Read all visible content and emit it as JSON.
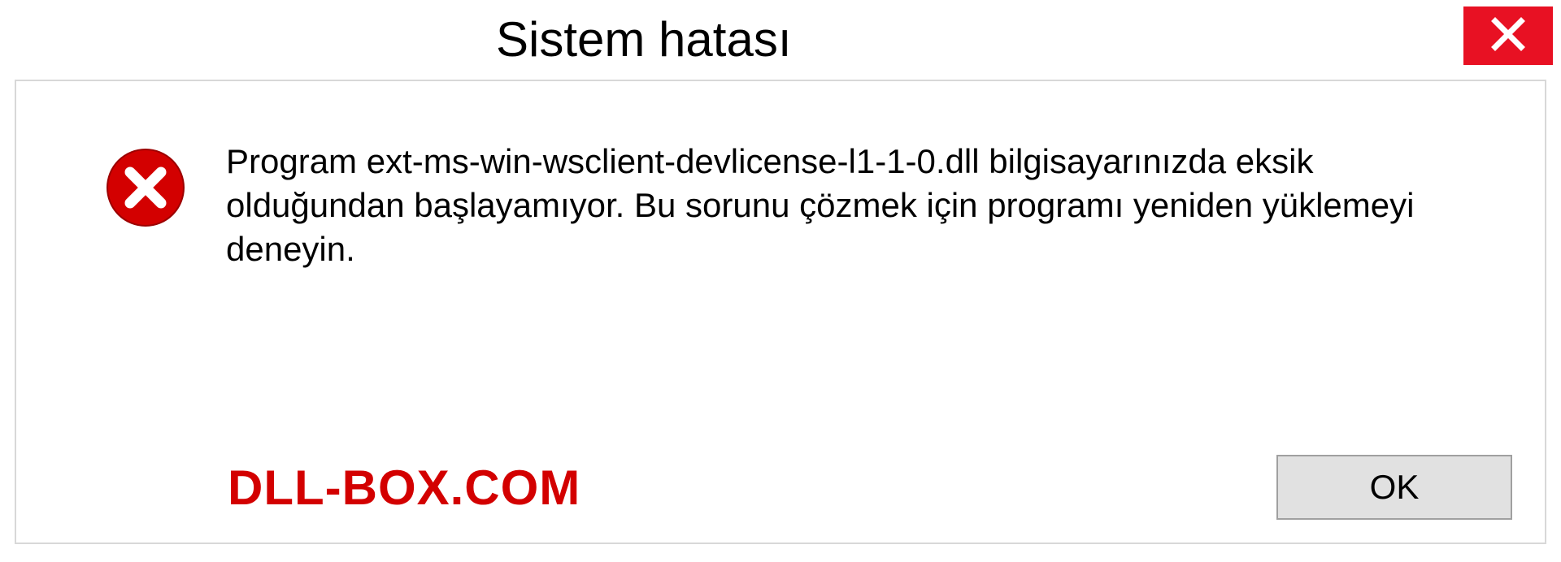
{
  "titlebar": {
    "title": "Sistem hatası"
  },
  "message": {
    "text": "Program ext-ms-win-wsclient-devlicense-l1-1-0.dll bilgisayarınızda eksik olduğundan başlayamıyor. Bu sorunu çözmek için programı yeniden yüklemeyi deneyin."
  },
  "footer": {
    "watermark": "DLL-BOX.COM",
    "ok_label": "OK"
  },
  "colors": {
    "close_bg": "#e81123",
    "error_icon": "#d30000",
    "watermark": "#d30000",
    "button_bg": "#e1e1e1",
    "border": "#d8d8d8"
  },
  "icons": {
    "close": "close-icon",
    "error": "error-icon"
  }
}
